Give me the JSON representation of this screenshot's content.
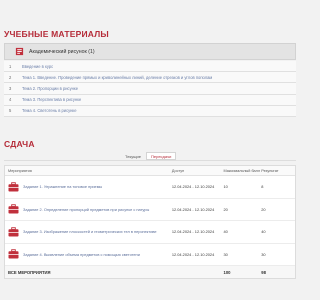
{
  "materials": {
    "title": "УЧЕБНЫЕ МАТЕРИАЛЫ",
    "course_name": "Академический рисунок (1)",
    "topics": [
      {
        "num": "1",
        "name": "Введение в курс"
      },
      {
        "num": "2",
        "name": "Тема 1. Введение. Проведение прямых и криволинейных линий, деление отрезков и углов пополам"
      },
      {
        "num": "3",
        "name": "Тема 2. Пропорции в рисунке"
      },
      {
        "num": "4",
        "name": "Тема 3. Перспектива в рисунке"
      },
      {
        "num": "5",
        "name": "Тема 4. Светотень в рисунке"
      }
    ]
  },
  "submission": {
    "title": "СДАЧА",
    "tabs": [
      "Текущие",
      "Пересдачи"
    ],
    "active_tab": 1,
    "columns": [
      "Мероприятия",
      "Доступ",
      "Максимальный балл",
      "Результат"
    ],
    "rows": [
      {
        "name": "Задание 1. Упражнение на тоновое приемы",
        "access": "12.04.2024 - 12.10.2024",
        "max": "10",
        "result": "8"
      },
      {
        "name": "Задание 2. Определение пропорций предметов при рисунке с натуры",
        "access": "12.04.2024 - 12.10.2024",
        "max": "20",
        "result": "20"
      },
      {
        "name": "Задание 3. Изображение плоскостей и геометрических тел в перспективе",
        "access": "12.04.2024 - 12.10.2024",
        "max": "40",
        "result": "40"
      },
      {
        "name": "Задание 4. Выявление объема предметов с помощью светотени",
        "access": "12.04.2024 - 12.10.2024",
        "max": "30",
        "result": "30"
      }
    ],
    "total_label": "ВСЕ МЕРОПРИЯТИЯ",
    "total_max": "100",
    "total_result": "98"
  },
  "colors": {
    "accent": "#b52b38",
    "link": "#5b6e9a"
  }
}
